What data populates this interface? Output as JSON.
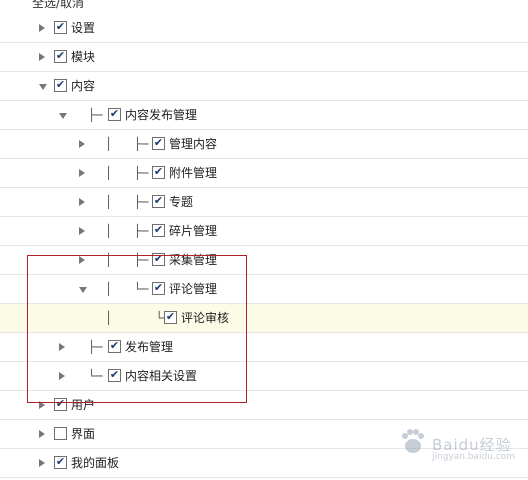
{
  "tree": {
    "select_all_label": "全选/取消",
    "rows": [
      {
        "label": "设置",
        "expanded": false,
        "checked": true,
        "connector": ""
      },
      {
        "label": "模块",
        "expanded": false,
        "checked": true,
        "connector": ""
      },
      {
        "label": "内容",
        "expanded": true,
        "checked": true,
        "connector": ""
      },
      {
        "label": "内容发布管理",
        "expanded": true,
        "checked": true,
        "connector": "├─"
      },
      {
        "label": "管理内容",
        "expanded": false,
        "checked": true,
        "connector": "│   ├─"
      },
      {
        "label": "附件管理",
        "expanded": false,
        "checked": true,
        "connector": "│   ├─"
      },
      {
        "label": "专题",
        "expanded": false,
        "checked": true,
        "connector": "│   ├─"
      },
      {
        "label": "碎片管理",
        "expanded": false,
        "checked": true,
        "connector": "│   ├─"
      },
      {
        "label": "采集管理",
        "expanded": false,
        "checked": true,
        "connector": "│   ├─"
      },
      {
        "label": "评论管理",
        "expanded": true,
        "checked": true,
        "connector": "│   └─"
      },
      {
        "label": "评论审核",
        "expanded": false,
        "checked": true,
        "connector": "│      └─"
      },
      {
        "label": "发布管理",
        "expanded": false,
        "checked": true,
        "connector": "├─"
      },
      {
        "label": "内容相关设置",
        "expanded": false,
        "checked": true,
        "connector": "└─"
      },
      {
        "label": "用户",
        "expanded": false,
        "checked": true,
        "connector": ""
      },
      {
        "label": "界面",
        "expanded": false,
        "checked": false,
        "connector": ""
      },
      {
        "label": "我的面板",
        "expanded": false,
        "checked": true,
        "connector": ""
      }
    ]
  },
  "watermark": {
    "text": "Baidu经验",
    "sub": "jingyan.baidu.com"
  },
  "colors": {
    "highlight_row": "#fcfce6",
    "annotation_box": "#b0202a",
    "checkmark": "#1e3a6e"
  }
}
